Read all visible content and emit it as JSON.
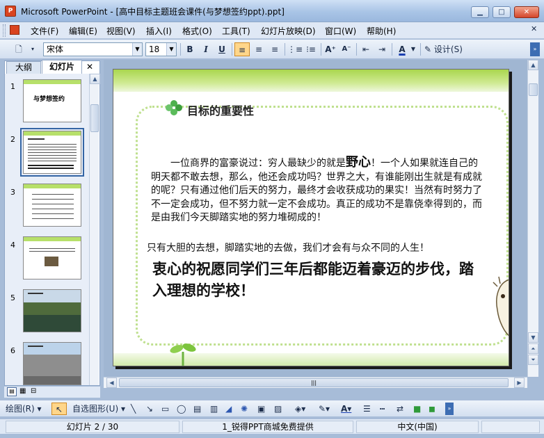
{
  "window": {
    "title": "Microsoft PowerPoint - [高中目标主题班会课件(与梦想签约ppt).ppt]",
    "app_icon": "P"
  },
  "menu": [
    "文件(F)",
    "编辑(E)",
    "视图(V)",
    "插入(I)",
    "格式(O)",
    "工具(T)",
    "幻灯片放映(D)",
    "窗口(W)",
    "帮助(H)"
  ],
  "format": {
    "font": "宋体",
    "size": "18",
    "bold": "B",
    "italic": "I",
    "underline": "U",
    "design": "设计(S)"
  },
  "tabs": {
    "outline": "大纲",
    "slides": "幻灯片",
    "close": "✕"
  },
  "thumbnails": [
    {
      "num": "1",
      "title": "与梦想签约"
    },
    {
      "num": "2"
    },
    {
      "num": "3"
    },
    {
      "num": "4"
    },
    {
      "num": "5"
    },
    {
      "num": "6"
    }
  ],
  "slide": {
    "title": "目标的重要性",
    "para1_a": "一位商界的富豪说过：穷人最缺少的就是",
    "para1_em": "野心",
    "para1_b": "！一个人如果就连自己的明天都不敢去想，那么，他还会成功吗？世界之大，有谁能刚出生就是有成就的呢？只有通过他们后天的努力，最终才会收获成功的果实！当然有时努力了不一定会成功，但不努力就一定不会成功。真正的成功不是靠侥幸得到的，而是由我们今天脚踏实地的努力堆砌成的！",
    "para2": "只有大胆的去想，脚踏实地的去做，我们才会有与众不同的人生！",
    "para3": "衷心的祝愿同学们三年后都能迈着豪迈的步伐，踏入理想的学校！"
  },
  "drawing": {
    "draw": "绘图(R)",
    "autoshape": "自选图形(U)"
  },
  "status": {
    "slide": "幻灯片 2 / 30",
    "design": "1_锐得PPT商城免费提供",
    "lang": "中文(中国)"
  },
  "colors": {
    "accent_green": "#a9d64e",
    "selection": "#3465a4"
  }
}
